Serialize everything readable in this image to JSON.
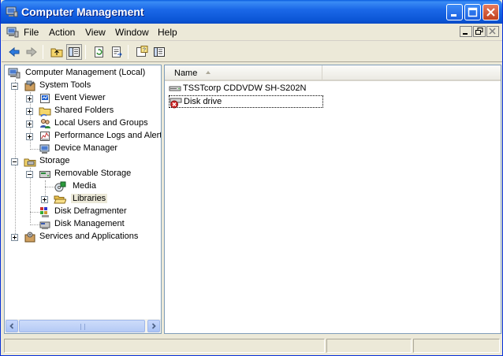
{
  "window": {
    "title": "Computer Management",
    "controls": {
      "minimize": "minimize-icon",
      "maximize": "maximize-icon",
      "close": "close-icon"
    }
  },
  "menubar": {
    "items": [
      {
        "label": "File"
      },
      {
        "label": "Action"
      },
      {
        "label": "View"
      },
      {
        "label": "Window"
      },
      {
        "label": "Help"
      }
    ]
  },
  "toolbar": {
    "buttons": [
      "back-icon",
      "forward-icon",
      "up-folder-icon",
      "show-hide-tree-icon",
      "refresh-icon",
      "export-list-icon",
      "help-icon",
      "properties-icon"
    ]
  },
  "tree": {
    "root": "Computer Management (Local)",
    "system_tools": "System Tools",
    "event_viewer": "Event Viewer",
    "shared_folders": "Shared Folders",
    "local_users": "Local Users and Groups",
    "perf_logs": "Performance Logs and Alerts",
    "device_manager": "Device Manager",
    "storage": "Storage",
    "removable_storage": "Removable Storage",
    "media": "Media",
    "libraries": "Libraries",
    "disk_defrag": "Disk Defragmenter",
    "disk_mgmt": "Disk Management",
    "services": "Services and Applications"
  },
  "list": {
    "columns": [
      {
        "label": "Name",
        "sorted": "ascending"
      }
    ],
    "rows": [
      {
        "name": "TSSTcorp CDDVDW SH-S202N",
        "icon": "cd-drive-icon"
      },
      {
        "name": "Disk drive",
        "icon": "disk-drive-error-icon"
      }
    ]
  },
  "colors": {
    "titlebar": "#0b56d6",
    "window_bg": "#ece9d8",
    "pane_border": "#7f9db9"
  }
}
